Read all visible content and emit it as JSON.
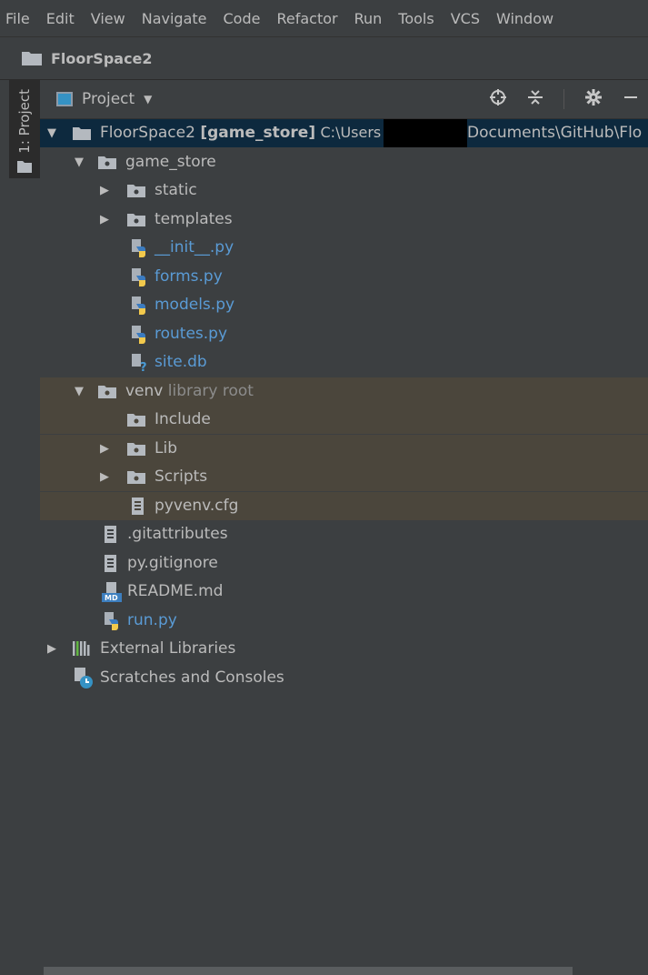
{
  "menu": [
    "File",
    "Edit",
    "View",
    "Navigate",
    "Code",
    "Refactor",
    "Run",
    "Tools",
    "VCS",
    "Window"
  ],
  "titlebar": {
    "project_name": "FloorSpace2"
  },
  "tool_strip": {
    "project_tab_label": "1: Project"
  },
  "panel": {
    "view_title": "Project",
    "header_icons": [
      "locate-icon",
      "collapse-all-icon",
      "gear-icon",
      "hide-icon"
    ]
  },
  "tree": {
    "root": {
      "name": "FloorSpace2",
      "module": "[game_store]",
      "path_prefix": "C:\\Users",
      "path_suffix": "Documents\\GitHub\\Flo"
    },
    "game_store": "game_store",
    "static": "static",
    "templates": "templates",
    "init": "__init__.py",
    "forms": "forms.py",
    "models": "models.py",
    "routes": "routes.py",
    "sitedb": "site.db",
    "venv": "venv",
    "venv_hint": "library root",
    "include": "Include",
    "lib": "Lib",
    "scripts": "Scripts",
    "pyvenv": "pyvenv.cfg",
    "gitattributes": ".gitattributes",
    "gitignore": "py.gitignore",
    "readme": "README.md",
    "run": "run.py",
    "external": "External Libraries",
    "scratches": "Scratches and Consoles"
  }
}
